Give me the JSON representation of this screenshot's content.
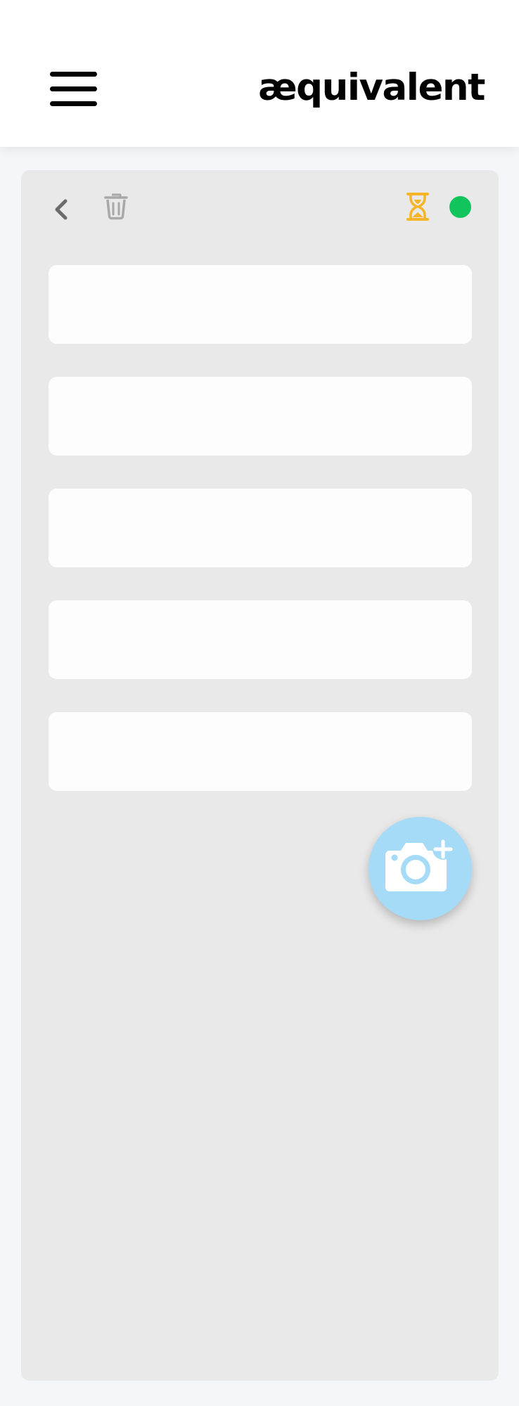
{
  "header": {
    "brand": "æquivalent",
    "menu_icon": "hamburger-menu-icon"
  },
  "toolbar": {
    "back_icon": "chevron-left-icon",
    "delete_icon": "trash-icon",
    "timer_icon": "hourglass-icon",
    "status_icon": "status-dot"
  },
  "form": {
    "fields": [
      {
        "value": "",
        "placeholder": ""
      },
      {
        "value": "",
        "placeholder": ""
      },
      {
        "value": "",
        "placeholder": ""
      },
      {
        "value": "",
        "placeholder": ""
      },
      {
        "value": "",
        "placeholder": ""
      }
    ]
  },
  "actions": {
    "add_photo_icon": "camera-plus-icon"
  },
  "colors": {
    "header_bg": "#ffffff",
    "page_bg": "#f5f6fa",
    "panel_bg": "#e9e9e9",
    "field_bg": "#fdfdfd",
    "icon_gray": "#6b6b6b",
    "trash_gray": "#a8a8a8",
    "timer_amber": "#f6b526",
    "status_green": "#11c45c",
    "fab_blue": "#a6dbf8"
  }
}
